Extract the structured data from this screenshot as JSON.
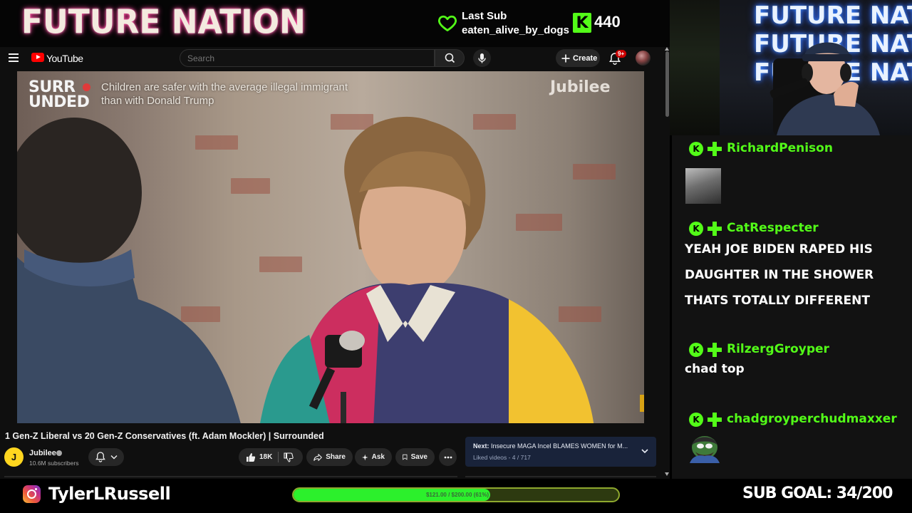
{
  "overlay": {
    "logo": "FUTURE NATION",
    "last_sub": {
      "title": "Last Sub",
      "name": "eaten_alive_by_dogs"
    },
    "kick_logo": "K",
    "viewer_count": "440",
    "accent_color": "#53fc18"
  },
  "youtube": {
    "brand": "YouTube",
    "search": {
      "placeholder": "Search"
    },
    "create_label": "Create",
    "notification_count": "9+",
    "video": {
      "overlay_logo_line1": "SURR",
      "overlay_logo_line2": "UNDED",
      "overlay_topic": "Children are safer with the average illegal immigrant than with Donald Trump",
      "watermark": "Jubilee",
      "corner_badge": "J"
    },
    "title": "1 Gen-Z Liberal vs 20 Gen-Z Conservatives (ft. Adam Mockler) | Surrounded",
    "channel": {
      "avatar_letter": "J",
      "name": "Jubilee",
      "subscribers": "10.6M subscribers"
    },
    "actions": {
      "likes": "18K",
      "share": "Share",
      "ask": "Ask",
      "save": "Save"
    },
    "next": {
      "label": "Next:",
      "title": "Insecure MAGA Incel BLAMES WOMEN for M...",
      "playlist": "Liked videos - 4 / 717"
    }
  },
  "webcam": {
    "sign_lines": [
      "FUTURE NATION",
      "FUTURE NATION",
      "FUTURE NATION"
    ]
  },
  "chat": {
    "messages": [
      {
        "user": "RichardPenison",
        "text": "",
        "emote": "gigachad-emote"
      },
      {
        "user": "CatRespecter",
        "lines": [
          "YEAH JOE BIDEN RAPED HIS",
          "DAUGHTER IN THE SHOWER",
          "THATS TOTALLY DIFFERENT"
        ]
      },
      {
        "user": "RilzergGroyper",
        "text": "chad top"
      },
      {
        "user": "chadgroyperchudmaxxer",
        "text": "",
        "emote": "pepe-emote"
      }
    ]
  },
  "footer": {
    "instagram_handle": "TylerLRussell",
    "goal_text": "$121.00 / $200.00 (61%)",
    "goal_progress": 0.605,
    "sub_goal": "SUB GOAL: 34/200"
  }
}
